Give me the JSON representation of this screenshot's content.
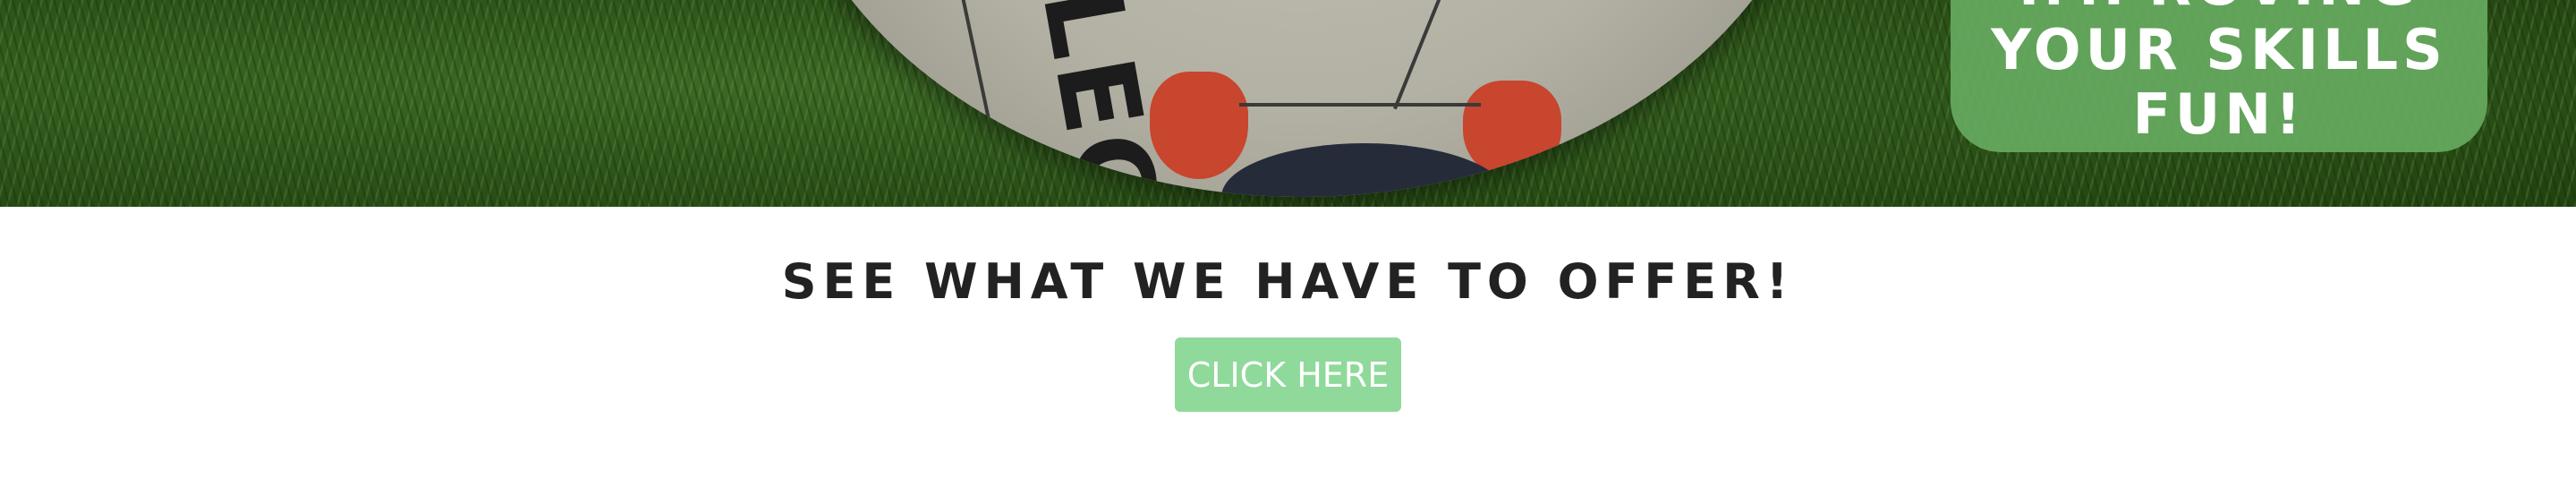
{
  "hero": {
    "banner_lines": [
      "IMPROVING",
      "YOUR SKILLS",
      "FUN!"
    ],
    "ball_logo_text": "SELECT"
  },
  "offer": {
    "title": "SEE WHAT WE HAVE TO OFFER!",
    "button_label": "CLICK HERE"
  },
  "colors": {
    "banner_green": "#66aa60",
    "button_green": "#8fd99a",
    "title_text": "#222222",
    "grass": "#2c5219"
  }
}
